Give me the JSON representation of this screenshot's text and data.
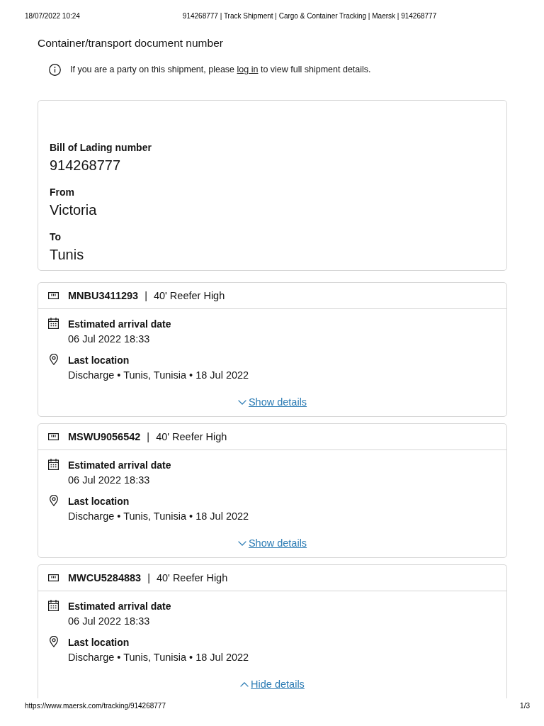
{
  "print_header": {
    "date": "18/07/2022 10:24",
    "title": "914268777 | Track Shipment | Cargo & Container Tracking | Maersk | 914268777"
  },
  "heading": "Container/transport document number",
  "notice": {
    "text_before": "If you are a party on this shipment, please",
    "link": "log in",
    "text_after": "to view full shipment details."
  },
  "summary": {
    "fields": [
      {
        "label": "Bill of Lading number",
        "value": "914268777"
      },
      {
        "label": "From",
        "value": "Victoria"
      },
      {
        "label": "To",
        "value": "Tunis"
      }
    ]
  },
  "containers": [
    {
      "id": "MNBU3411293",
      "separator": "|",
      "type": "40' Reefer High",
      "eta_label": "Estimated arrival date",
      "eta": "06 Jul 2022 18:33",
      "location_label": "Last location",
      "location": "Discharge • Tunis, Tunisia • 18 Jul 2022",
      "toggle_label": "Show details",
      "expanded": false
    },
    {
      "id": "MSWU9056542",
      "separator": "|",
      "type": "40' Reefer High",
      "eta_label": "Estimated arrival date",
      "eta": "06 Jul 2022 18:33",
      "location_label": "Last location",
      "location": "Discharge • Tunis, Tunisia • 18 Jul 2022",
      "toggle_label": "Show details",
      "expanded": false
    },
    {
      "id": "MWCU5284883",
      "separator": "|",
      "type": "40' Reefer High",
      "eta_label": "Estimated arrival date",
      "eta": "06 Jul 2022 18:33",
      "location_label": "Last location",
      "location": "Discharge • Tunis, Tunisia • 18 Jul 2022",
      "toggle_label": "Hide details",
      "expanded": true
    }
  ],
  "footer": {
    "url": "https://www.maersk.com/tracking/914268777",
    "page": "1/3"
  }
}
